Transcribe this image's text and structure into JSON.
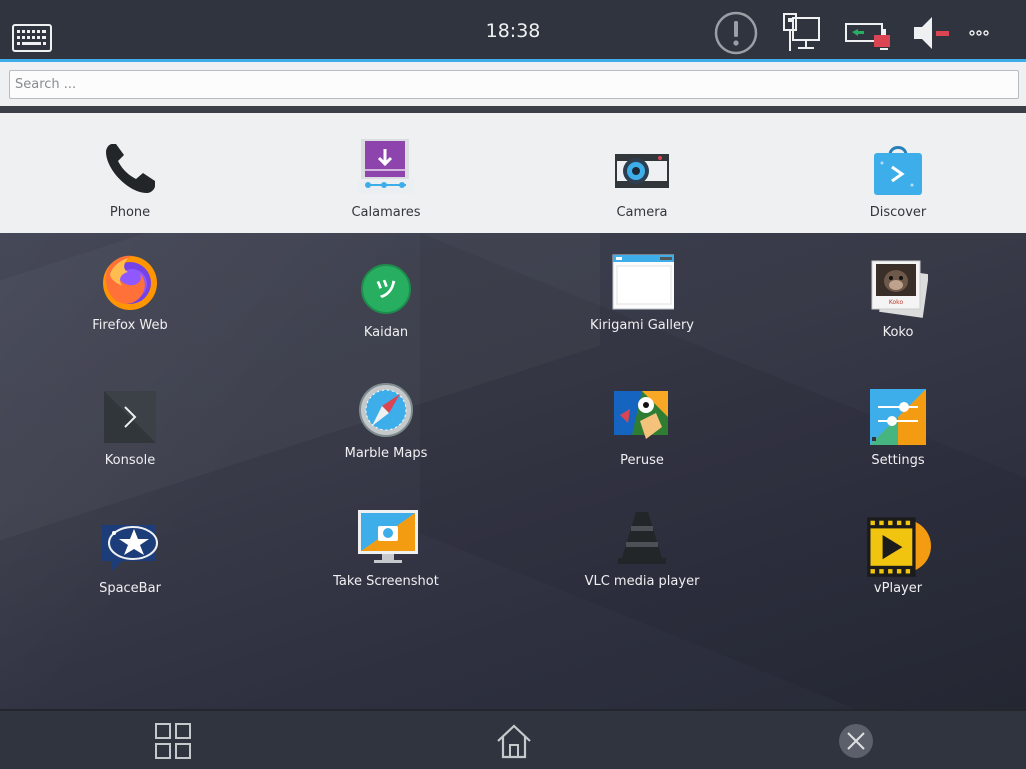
{
  "status_bar": {
    "time": "18:38",
    "icons": [
      "virtual-keyboard-icon",
      "notification-alert-icon",
      "network-wired-icon",
      "battery-charging-icon",
      "volume-muted-icon",
      "more-options-icon"
    ]
  },
  "search": {
    "placeholder": "Search ...",
    "value": ""
  },
  "favorites": [
    {
      "label": "Phone",
      "icon": "phone-icon"
    },
    {
      "label": "Calamares",
      "icon": "calamares-installer-icon"
    },
    {
      "label": "Camera",
      "icon": "camera-icon"
    },
    {
      "label": "Discover",
      "icon": "discover-store-icon"
    }
  ],
  "apps": [
    {
      "label": "Firefox Web",
      "icon": "firefox-icon"
    },
    {
      "label": "Kaidan",
      "icon": "kaidan-chat-icon"
    },
    {
      "label": "Kirigami Gallery",
      "icon": "kirigami-gallery-icon"
    },
    {
      "label": "Koko",
      "icon": "koko-photos-icon"
    },
    {
      "label": "Konsole",
      "icon": "terminal-icon"
    },
    {
      "label": "Marble Maps",
      "icon": "marble-compass-icon"
    },
    {
      "label": "Peruse",
      "icon": "peruse-comic-icon"
    },
    {
      "label": "Settings",
      "icon": "settings-sliders-icon"
    },
    {
      "label": "SpaceBar",
      "icon": "spacebar-messages-icon"
    },
    {
      "label": "Take Screenshot",
      "icon": "screenshot-icon"
    },
    {
      "label": "VLC media player",
      "icon": "vlc-cone-icon"
    },
    {
      "label": "vPlayer",
      "icon": "vplayer-film-icon"
    }
  ],
  "nav_bar": {
    "icons": [
      "app-grid-icon",
      "home-icon",
      "close-icon"
    ]
  },
  "colors": {
    "panel": "#2f343f",
    "accent": "#3daee9",
    "light_surface": "#eff0f1"
  }
}
